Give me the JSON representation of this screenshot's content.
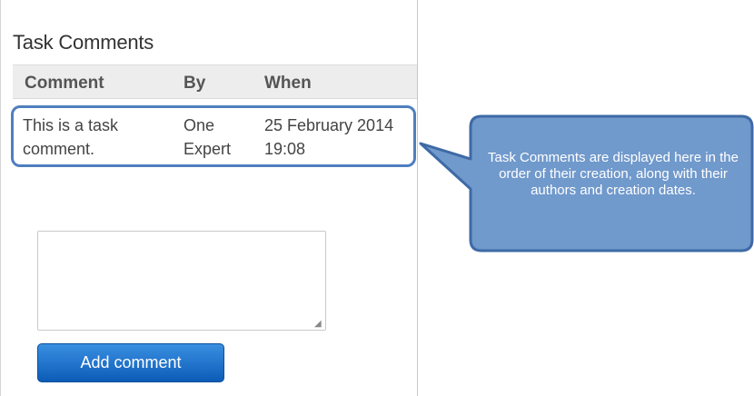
{
  "panel": {
    "title": "Task Comments",
    "columns": {
      "comment": "Comment",
      "by": "By",
      "when": "When"
    },
    "rows": [
      {
        "comment_line1": "This is a task",
        "comment_line2": "comment.",
        "by_line1": "One",
        "by_line2": "Expert",
        "when_line1": "25 February 2014",
        "when_line2": "19:08"
      }
    ],
    "comment_input": {
      "value": "",
      "placeholder": ""
    },
    "add_button_label": "Add comment"
  },
  "callout": {
    "text": "Task Comments are displayed here in the order of their creation, along with their authors and creation dates."
  },
  "colors": {
    "callout_fill": "#7099cc",
    "callout_border": "#3e6aa6",
    "highlight": "#4f7fbf",
    "button": "#1a6fd0"
  }
}
